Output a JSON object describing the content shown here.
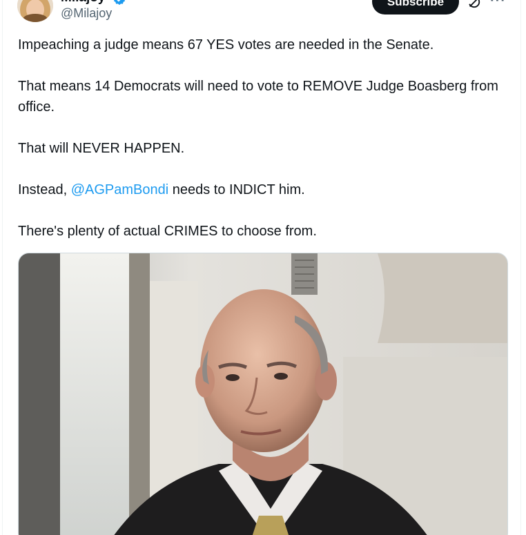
{
  "author": {
    "display_name": "Milajoy",
    "handle": "@Milajoy"
  },
  "header": {
    "subscribe_label": "Subscribe",
    "more_label": "···"
  },
  "tweet": {
    "p1": "Impeaching a judge means 67 YES votes are needed in the Senate.",
    "p2": "That means 14 Democrats will need to vote to REMOVE Judge Boasberg from office.",
    "p3": "That will NEVER HAPPEN.",
    "p4_before": "Instead, ",
    "p4_mention": "@AGPamBondi",
    "p4_after": " needs to INDICT him.",
    "p5": "There's plenty of actual CRIMES to choose from."
  },
  "icons": {
    "verified": "verified-badge-icon",
    "grok": "grok-icon",
    "more": "more-icon"
  },
  "colors": {
    "link": "#1d9bf0",
    "button_bg": "#0f1419",
    "secondary_text": "#536471"
  }
}
